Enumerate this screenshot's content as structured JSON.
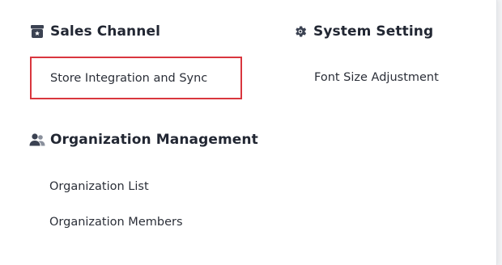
{
  "sales_channel": {
    "title": "Sales Channel",
    "icon": "store-icon",
    "items": [
      {
        "label": "Store Integration and Sync",
        "highlighted": true
      }
    ]
  },
  "system_setting": {
    "title": "System Setting",
    "icon": "gear-icon",
    "items": [
      {
        "label": "Font Size Adjustment"
      }
    ]
  },
  "organization_management": {
    "title": "Organization Management",
    "icon": "users-icon",
    "items": [
      {
        "label": "Organization List"
      },
      {
        "label": "Organization Members"
      }
    ]
  },
  "colors": {
    "icon": "#3b4252",
    "highlight_border": "#d9363e",
    "text": "#2b2f38",
    "heading": "#222733"
  }
}
